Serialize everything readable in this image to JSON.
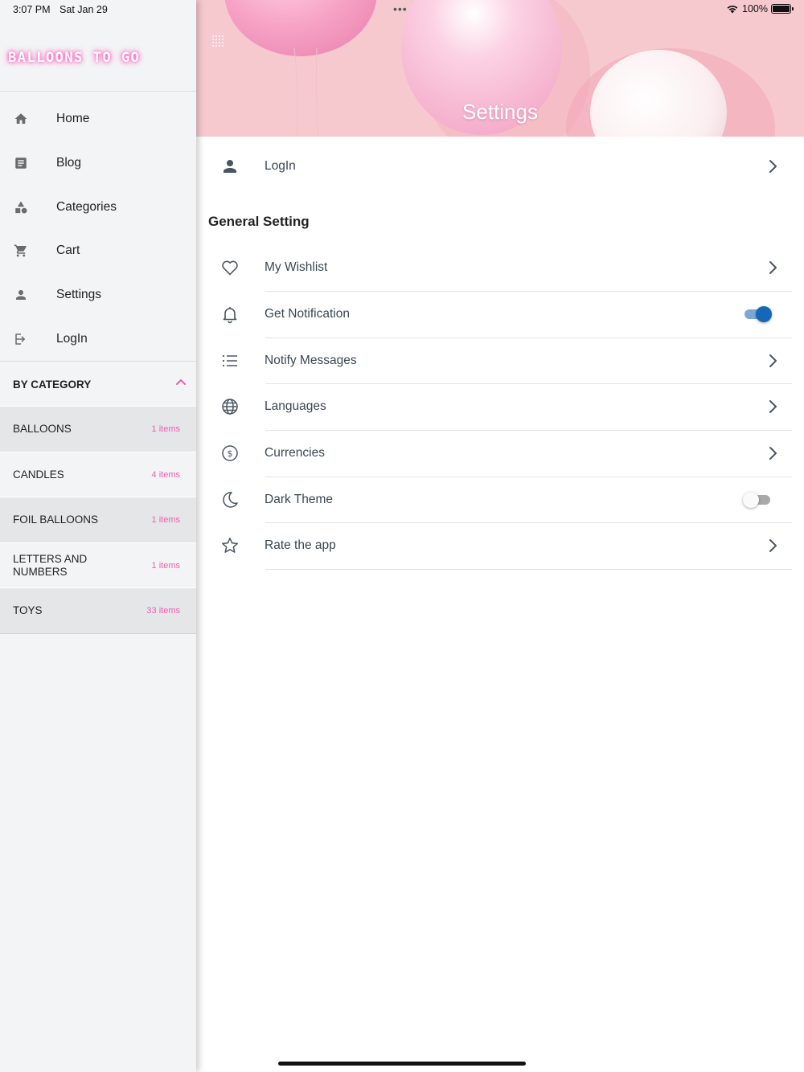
{
  "status_bar": {
    "time": "3:07 PM",
    "date": "Sat Jan 29",
    "dots": "•••",
    "battery": "100%"
  },
  "sidebar": {
    "logo": "BALLOONS TO GO",
    "nav": [
      {
        "label": "Home",
        "icon": "home-icon"
      },
      {
        "label": "Blog",
        "icon": "article-icon"
      },
      {
        "label": "Categories",
        "icon": "shapes-icon"
      },
      {
        "label": "Cart",
        "icon": "cart-icon"
      },
      {
        "label": "Settings",
        "icon": "person-icon"
      },
      {
        "label": "LogIn",
        "icon": "login-icon"
      }
    ],
    "category_header": "BY CATEGORY",
    "categories": [
      {
        "name": "BALLOONS",
        "count": "1 items"
      },
      {
        "name": "CANDLES",
        "count": "4 items"
      },
      {
        "name": "FOIL BALLOONS",
        "count": "1 items"
      },
      {
        "name": "LETTERS AND NUMBERS",
        "count": "1 items"
      },
      {
        "name": "TOYS",
        "count": "33 items"
      }
    ]
  },
  "header": {
    "title": "Settings"
  },
  "settings": {
    "login": {
      "label": "LogIn",
      "icon": "person-icon"
    },
    "section_title": "General Setting",
    "items": [
      {
        "label": "My Wishlist",
        "icon": "heart-icon",
        "control": "chevron"
      },
      {
        "label": "Get Notification",
        "icon": "bell-icon",
        "control": "toggle",
        "value": true
      },
      {
        "label": "Notify Messages",
        "icon": "list-icon",
        "control": "chevron"
      },
      {
        "label": "Languages",
        "icon": "globe-icon",
        "control": "chevron"
      },
      {
        "label": "Currencies",
        "icon": "dollar-icon",
        "control": "chevron"
      },
      {
        "label": "Dark Theme",
        "icon": "moon-icon",
        "control": "toggle",
        "value": false
      },
      {
        "label": "Rate the app",
        "icon": "star-icon",
        "control": "chevron"
      }
    ]
  },
  "colors": {
    "accent": "#ee5fb0",
    "toggle_on": "#1567b8",
    "header_bg": "#f6c9cf",
    "sidebar_bg": "#f3f4f5"
  }
}
